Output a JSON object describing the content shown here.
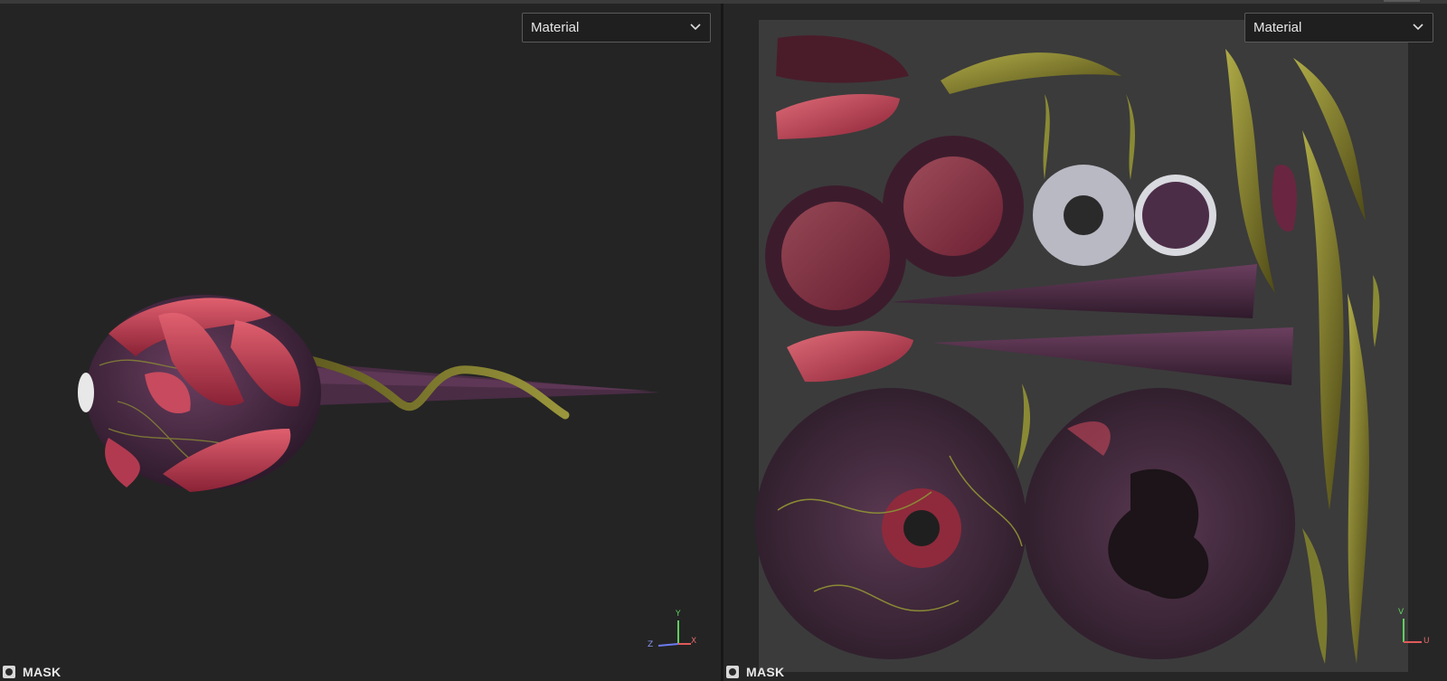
{
  "viewports": {
    "left": {
      "mode_dropdown": {
        "value": "Material"
      },
      "mask": {
        "label": "MASK"
      },
      "axis_gizmo": {
        "y": "Y",
        "z": "Z",
        "x": "X"
      }
    },
    "right": {
      "mode_dropdown": {
        "value": "Material"
      },
      "mask": {
        "label": "MASK"
      },
      "axis_gizmo": {
        "v": "V",
        "u": "U"
      }
    }
  },
  "icons": [
    "chevron-down-icon",
    "mask-toggle-icon",
    "axis-gizmo-icon"
  ],
  "colors": {
    "viewport_bg": "#242424",
    "uv_sheet_bg": "#3b3b3b",
    "flesh_red": "#c8485c",
    "eye_purple": "#4c2c44",
    "nerve_yellow": "#8a8a35",
    "axis_y": "#5fcf5f",
    "axis_x": "#e05a5a",
    "axis_z": "#6c7cf0"
  }
}
